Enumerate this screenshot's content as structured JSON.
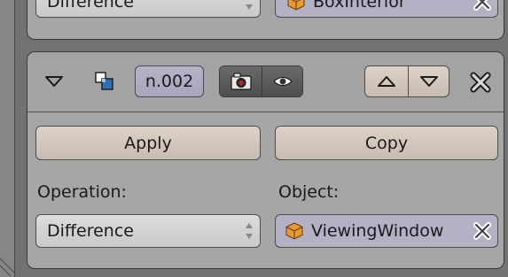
{
  "top_panel": {
    "operation_value": "Difference",
    "object_value": "BoxInterior"
  },
  "modifier": {
    "name": "n.002",
    "apply_label": "Apply",
    "copy_label": "Copy",
    "operation_label": "Operation:",
    "operation_value": "Difference",
    "object_label": "Object:",
    "object_value": "ViewingWindow"
  },
  "colors": {
    "panel_bg": "#a6a6a6",
    "button_bg": "#d4c9be",
    "object_field_bg": "#b5b0c4",
    "render_toggle_bg": "#5a5a5a"
  }
}
